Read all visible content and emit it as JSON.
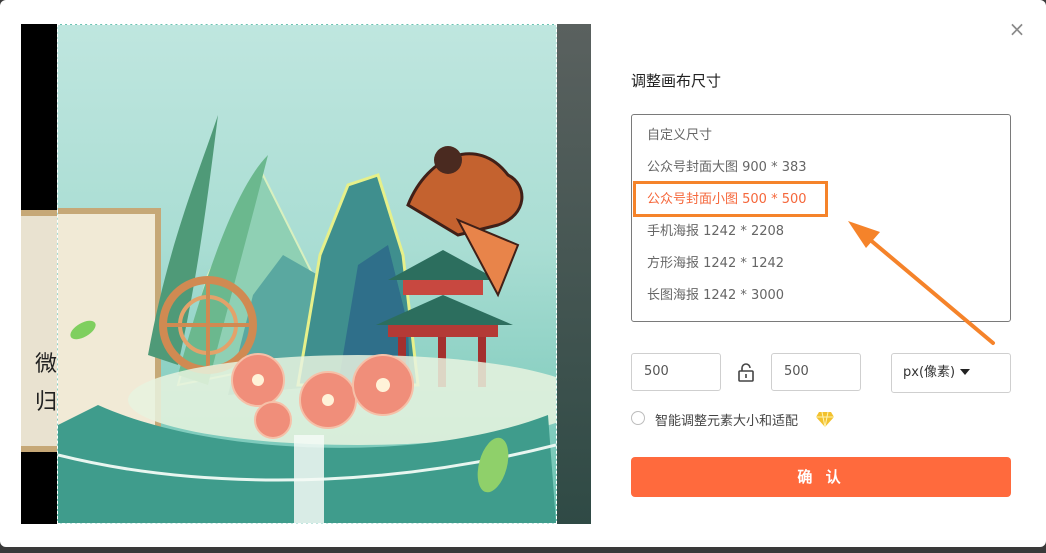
{
  "dialog": {
    "title": "调整画布尺寸",
    "close_icon": "×"
  },
  "preview": {
    "side_text_line1": "微",
    "side_text_line2": "归"
  },
  "size_list": {
    "items": [
      {
        "label": "自定义尺寸"
      },
      {
        "label": "公众号封面大图 900 * 383"
      },
      {
        "label": "公众号封面小图 500 * 500"
      },
      {
        "label": "手机海报 1242 * 2208"
      },
      {
        "label": "方形海报 1242 * 1242"
      },
      {
        "label": "长图海报 1242 * 3000"
      }
    ],
    "selected_index": 2
  },
  "dimensions": {
    "width_value": "500",
    "height_value": "500",
    "lock_icon": "unlock-icon",
    "unit_label": "px(像素)"
  },
  "smart_resize": {
    "label": "智能调整元素大小和适配",
    "checked": false,
    "premium_icon": "diamond-icon"
  },
  "confirm_label": "确 认",
  "colors": {
    "accent": "#ff6a3d",
    "highlight": "#f5832a",
    "selected_text": "#f5673b"
  }
}
